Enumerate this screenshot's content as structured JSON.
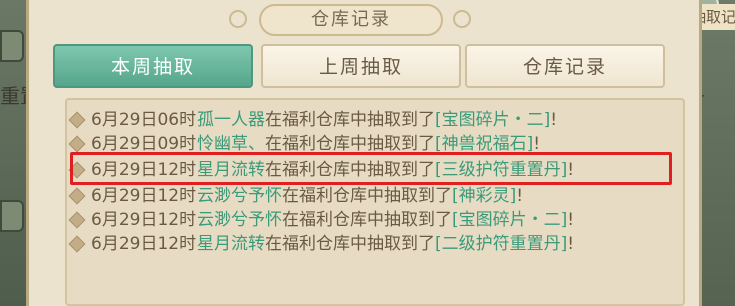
{
  "background": {
    "right_tab_label": "抽取记",
    "left_partial_text": "重置丹",
    "right_partial_text": "丹"
  },
  "dialog": {
    "title": "仓库记录"
  },
  "tabs": [
    {
      "label": "本周抽取",
      "active": true
    },
    {
      "label": "上周抽取",
      "active": false
    },
    {
      "label": "仓库记录",
      "active": false
    }
  ],
  "records": [
    {
      "time": "6月29日06时",
      "player": "孤一人器",
      "text": "在福利仓库中抽取到了",
      "item": "[宝图碎片・二]",
      "end": "!"
    },
    {
      "time": "6月29日09时",
      "player": "怜幽草、",
      "text": "在福利仓库中抽取到了",
      "item": "[神兽祝福石]",
      "end": "!"
    },
    {
      "time": "6月29日12时",
      "player": "星月流转",
      "text": "在福利仓库中抽取到了",
      "item": "[三级护符重置丹]",
      "end": "!"
    },
    {
      "time": "6月29日12时",
      "player": "云渺兮予怀",
      "text": "在福利仓库中抽取到了",
      "item": "[神彩灵]",
      "end": "!"
    },
    {
      "time": "6月29日12时",
      "player": "云渺兮予怀",
      "text": "在福利仓库中抽取到了",
      "item": "[宝图碎片・二]",
      "end": "!"
    },
    {
      "time": "6月29日12时",
      "player": "星月流转",
      "text": "在福利仓库中抽取到了",
      "item": "[二级护符重置丹]",
      "end": "!"
    }
  ],
  "colors": {
    "player_name": "#3a9a7a",
    "item_name": "#3a9a7a",
    "body_text": "#6a5a44",
    "highlight_box": "#e02020",
    "active_tab": "#55a68c"
  }
}
